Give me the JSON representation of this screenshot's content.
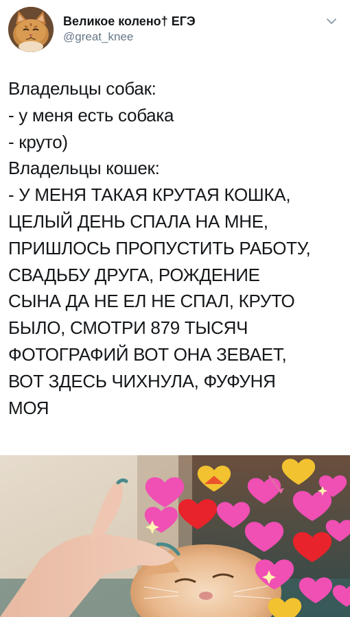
{
  "tweet": {
    "author": {
      "display_name": "Великое колено† ЕГЭ",
      "handle": "@great_knee",
      "avatar_icon": "cat-avatar"
    },
    "menu_icon": "chevron-down-icon",
    "text_lines": [
      "Владельцы собак:",
      "- у меня есть собака",
      "- круто)",
      "Владельцы кошек:",
      "- У МЕНЯ ТАКАЯ КРУТАЯ КОШКА,",
      "ЦЕЛЫЙ ДЕНЬ СПАЛА НА МНЕ,",
      "ПРИШЛОСЬ ПРОПУСТИТЬ РАБОТУ,",
      "СВАДЬБУ ДРУГА, РОЖДЕНИЕ",
      "СЫНА ДА НЕ ЕЛ НЕ СПАЛ, КРУТО",
      "БЫЛО, СМОТРИ 879 ТЫСЯЧ",
      "ФОТОГРАФИЙ ВОТ ОНА ЗЕВАЕТ,",
      "ВОТ ЗДЕСЬ ЧИХНУЛА, ФУФУНЯ",
      "МОЯ"
    ],
    "photo": {
      "description_icon": "cat-with-hearts-image",
      "colors": {
        "heart_pink": "#f04fb4",
        "heart_red": "#e8232b",
        "heart_gold": "#f2c230"
      }
    }
  }
}
